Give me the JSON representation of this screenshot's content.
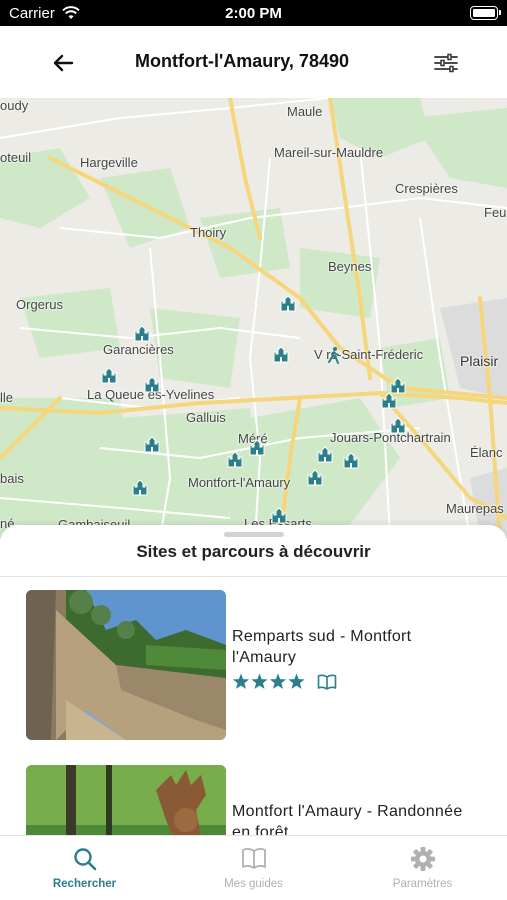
{
  "status_bar": {
    "carrier": "Carrier",
    "time": "2:00 PM"
  },
  "nav": {
    "title": "Montfort-l'Amaury, 78490",
    "back_icon": "arrow-left-icon",
    "filter_icon": "sliders-icon"
  },
  "map": {
    "labels": [
      {
        "text": "Maule"
      },
      {
        "text": "Mareil-sur-Mauldre"
      },
      {
        "text": "Hargeville"
      },
      {
        "text": "oteuil"
      },
      {
        "text": "Crespières"
      },
      {
        "text": "Feu"
      },
      {
        "text": "Thoiry"
      },
      {
        "text": "Beynes"
      },
      {
        "text": "Orgerus"
      },
      {
        "text": "Garancières"
      },
      {
        "text": "V rs-Saint-Fréderic"
      },
      {
        "text": "Plaisir"
      },
      {
        "text": "La Queue  es-Yvelines"
      },
      {
        "text": "lle"
      },
      {
        "text": "Galluis"
      },
      {
        "text": "Méré"
      },
      {
        "text": "Jouars-Pontchartrain"
      },
      {
        "text": "Élanc"
      },
      {
        "text": "bais"
      },
      {
        "text": "Montfort-l'Amaury"
      },
      {
        "text": "Maurepas"
      },
      {
        "text": "Gambaiseuil"
      },
      {
        "text": "Les Essarts"
      },
      {
        "text": "né"
      },
      {
        "text": "oudy"
      }
    ],
    "pin_icon": "castle-pin-icon",
    "hiker_icon": "hiker-pin-icon",
    "colors": {
      "land": "#ecebe6",
      "forest": "#cfe8c8",
      "road": "#f6d67a",
      "pin": "#2a7f8a"
    }
  },
  "sheet": {
    "title": "Sites et parcours à découvrir",
    "items": [
      {
        "title": "Remparts sud - Montfort l'Amaury",
        "rating": 4,
        "guide_icon": "book-icon"
      },
      {
        "title": "Montfort l'Amaury - Randonnée en forêt"
      }
    ]
  },
  "tabs": [
    {
      "label": "Rechercher",
      "icon": "search-icon",
      "active": true
    },
    {
      "label": "Mes guides",
      "icon": "book-icon",
      "active": false
    },
    {
      "label": "Paramètres",
      "icon": "gear-icon",
      "active": false
    }
  ],
  "accent": "#2a7f8a"
}
